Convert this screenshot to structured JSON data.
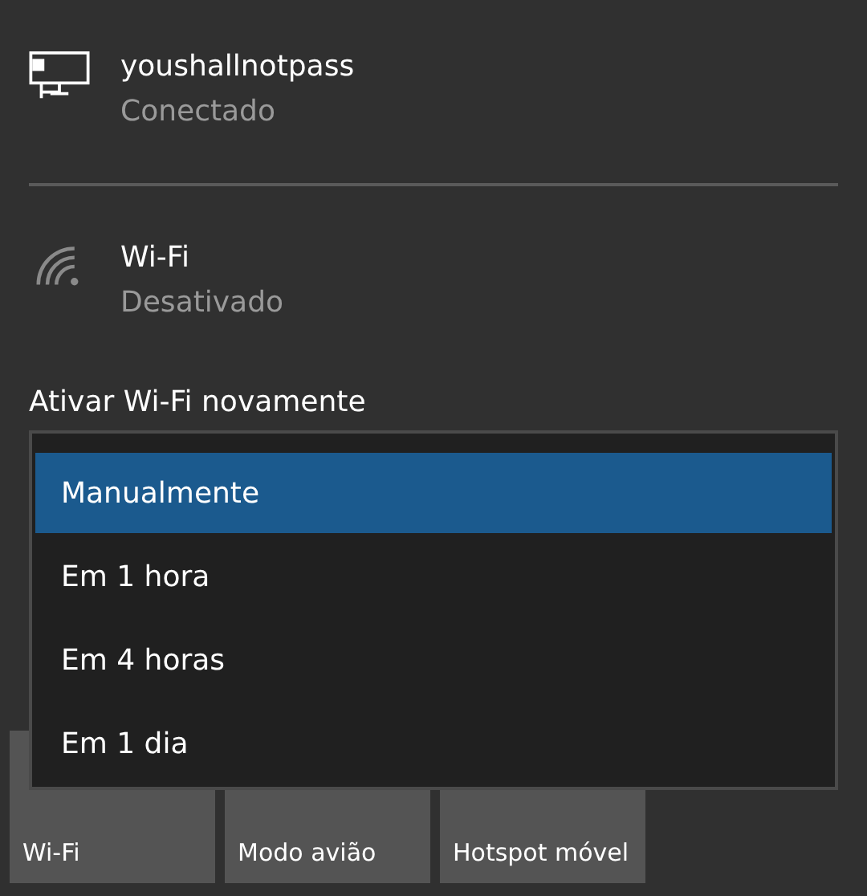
{
  "networks": [
    {
      "kind": "ethernet",
      "name": "youshallnotpass",
      "status": "Conectado"
    },
    {
      "kind": "wifi",
      "name": "Wi-Fi",
      "status": "Desativado"
    }
  ],
  "reenable": {
    "label": "Ativar Wi-Fi novamente",
    "options": [
      {
        "label": "Manualmente",
        "selected": true
      },
      {
        "label": "Em 1 hora",
        "selected": false
      },
      {
        "label": "Em 4 horas",
        "selected": false
      },
      {
        "label": "Em 1 dia",
        "selected": false
      }
    ]
  },
  "tiles": [
    {
      "label": "Wi-Fi"
    },
    {
      "label": "Modo avião"
    },
    {
      "label": "Hotspot móvel"
    }
  ]
}
